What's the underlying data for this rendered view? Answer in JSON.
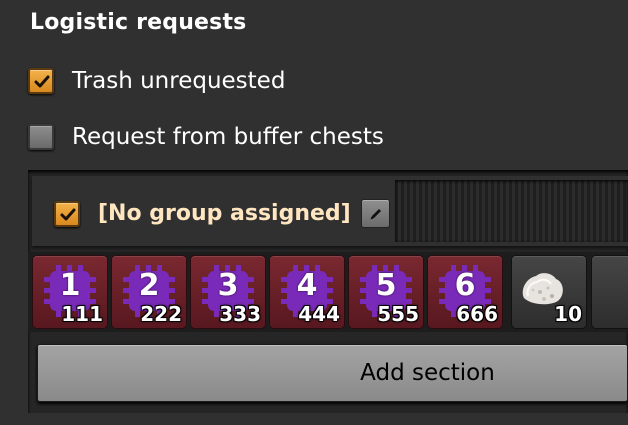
{
  "panel": {
    "title": "Logistic requests"
  },
  "options": {
    "trash_unrequested": {
      "label": "Trash unrequested",
      "checked": true
    },
    "request_from_buffer": {
      "label": "Request from buffer chests",
      "checked": false
    }
  },
  "group": {
    "enabled": true,
    "label": "[No group assigned]",
    "edit_icon": "pencil-icon"
  },
  "slots": [
    {
      "digit": "1",
      "count": "111",
      "icon": "signal-1-icon"
    },
    {
      "digit": "2",
      "count": "222",
      "icon": "signal-2-icon"
    },
    {
      "digit": "3",
      "count": "333",
      "icon": "signal-3-icon"
    },
    {
      "digit": "4",
      "count": "444",
      "icon": "signal-4-icon"
    },
    {
      "digit": "5",
      "count": "555",
      "icon": "signal-5-icon"
    },
    {
      "digit": "6",
      "count": "666",
      "icon": "signal-6-icon"
    },
    {
      "count": "10",
      "icon": "stone-icon"
    }
  ],
  "actions": {
    "add_section": "Add section"
  },
  "colors": {
    "background": "#313031",
    "checkbox_on": "#e89b2c",
    "slot_red": "#6a2028",
    "chip_purple": "#7a2ab8",
    "group_label": "#ffe6c0"
  }
}
